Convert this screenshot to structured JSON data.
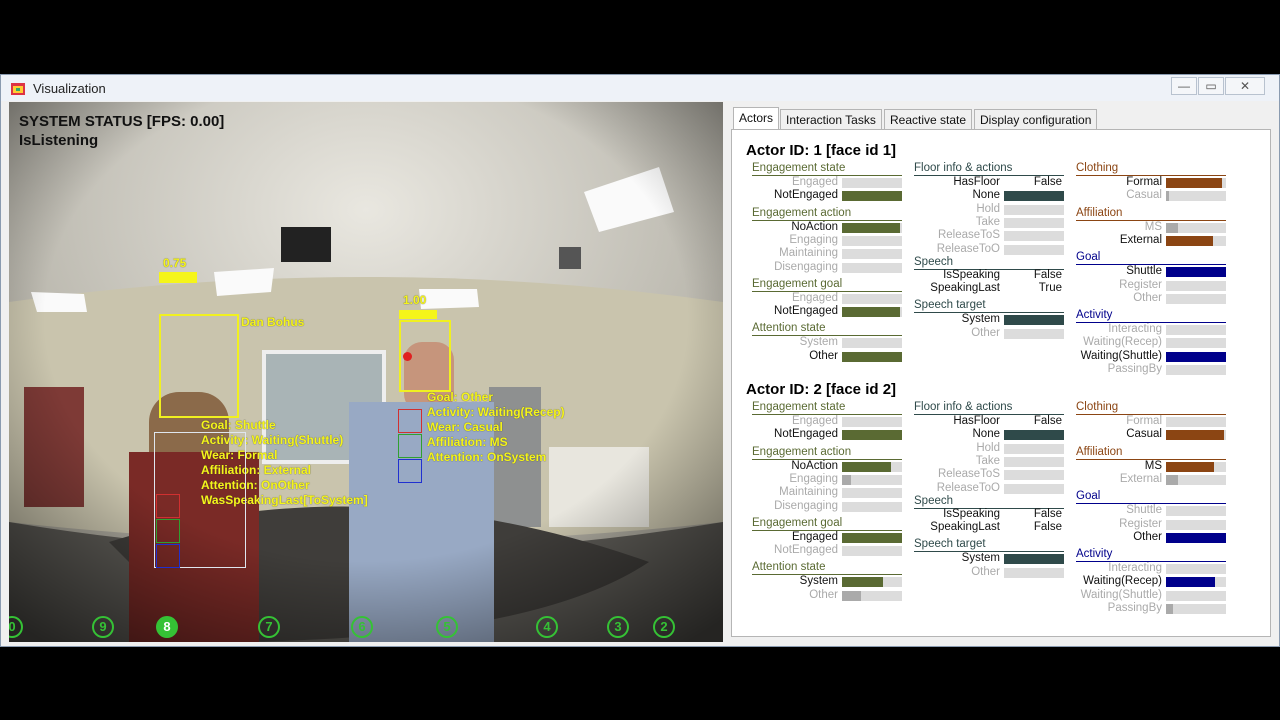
{
  "window": {
    "title": "Visualization",
    "minimize": "—",
    "restore": "▭",
    "close": "✕"
  },
  "camera": {
    "status_line1": "SYSTEM STATUS [FPS: 0.00]",
    "status_line2": "IsListening",
    "person1": {
      "confidence": "0.75",
      "name": "Dan Bohus",
      "lines": [
        "Goal: Shuttle",
        "Activity: Waiting(Shuttle)",
        "Wear: Formal",
        "Affiliation: External",
        "Attention: OnOther",
        "WasSpeakingLast[ToSystem]"
      ]
    },
    "person2": {
      "confidence": "1.00",
      "lines": [
        "Goal: Other",
        "Activity: Waiting(Recep)",
        "Wear: Casual",
        "Affiliation: MS",
        "Attention: OnSystem"
      ]
    },
    "markers": [
      {
        "label": "0",
        "active": false
      },
      {
        "label": "9",
        "active": false
      },
      {
        "label": "8",
        "active": true
      },
      {
        "label": "7",
        "active": false
      },
      {
        "label": "6",
        "active": false
      },
      {
        "label": "5",
        "active": false
      },
      {
        "label": "4",
        "active": false
      },
      {
        "label": "3",
        "active": false
      },
      {
        "label": "2",
        "active": false
      }
    ]
  },
  "tabs": [
    "Actors",
    "Interaction Tasks",
    "Reactive state",
    "Display configuration"
  ],
  "active_tab": "Actors",
  "colors": {
    "olive": "#5a6a33",
    "slate": "#2f4a4a",
    "brown": "#8b4513",
    "navy": "#00008b",
    "bar_bg": "#dcdcdc"
  },
  "actors": [
    {
      "title": "Actor ID: 1 [face id 1]",
      "col1": [
        {
          "section": "Engagement state",
          "items": [
            {
              "label": "Engaged",
              "value": 0.0,
              "active": false
            },
            {
              "label": "NotEngaged",
              "value": 1.0,
              "active": true
            }
          ]
        },
        {
          "section": "Engagement action",
          "items": [
            {
              "label": "NoAction",
              "value": 0.97,
              "active": true
            },
            {
              "label": "Engaging",
              "value": 0.0,
              "active": false
            },
            {
              "label": "Maintaining",
              "value": 0.0,
              "active": false
            },
            {
              "label": "Disengaging",
              "value": 0.0,
              "active": false
            }
          ]
        },
        {
          "section": "Engagement goal",
          "items": [
            {
              "label": "Engaged",
              "value": 0.0,
              "active": false
            },
            {
              "label": "NotEngaged",
              "value": 0.97,
              "active": true
            }
          ]
        },
        {
          "section": "Attention state",
          "items": [
            {
              "label": "System",
              "value": 0.0,
              "active": false
            },
            {
              "label": "Other",
              "value": 1.0,
              "active": true
            }
          ]
        }
      ],
      "col2": {
        "floor_title": "Floor info & actions",
        "floor": [
          {
            "label": "HasFloor",
            "text": "False"
          },
          {
            "label": "None",
            "value": 1.0,
            "active": true
          },
          {
            "label": "Hold",
            "value": 0.0,
            "active": false
          },
          {
            "label": "Take",
            "value": 0.0,
            "active": false
          },
          {
            "label": "ReleaseToS",
            "value": 0.0,
            "active": false
          },
          {
            "label": "ReleaseToO",
            "value": 0.0,
            "active": false
          }
        ],
        "speech_title": "Speech",
        "speech": [
          {
            "label": "IsSpeaking",
            "text": "False"
          },
          {
            "label": "SpeakingLast",
            "text": "True"
          }
        ],
        "target_title": "Speech target",
        "target": [
          {
            "label": "System",
            "value": 1.0,
            "active": true
          },
          {
            "label": "Other",
            "value": 0.0,
            "active": false
          }
        ]
      },
      "col3": [
        {
          "section": "Clothing",
          "items": [
            {
              "label": "Formal",
              "value": 0.93,
              "active": true
            },
            {
              "label": "Casual",
              "value": 0.05,
              "active": false
            }
          ]
        },
        {
          "section": "Affiliation",
          "items": [
            {
              "label": "MS",
              "value": 0.2,
              "active": false
            },
            {
              "label": "External",
              "value": 0.78,
              "active": true
            }
          ]
        },
        {
          "section": "Goal",
          "items": [
            {
              "label": "Shuttle",
              "value": 1.0,
              "active": true
            },
            {
              "label": "Register",
              "value": 0.0,
              "active": false
            },
            {
              "label": "Other",
              "value": 0.0,
              "active": false
            }
          ]
        },
        {
          "section": "Activity",
          "items": [
            {
              "label": "Interacting",
              "value": 0.0,
              "active": false
            },
            {
              "label": "Waiting(Recep)",
              "value": 0.0,
              "active": false
            },
            {
              "label": "Waiting(Shuttle)",
              "value": 1.0,
              "active": true
            },
            {
              "label": "PassingBy",
              "value": 0.0,
              "active": false
            }
          ]
        }
      ]
    },
    {
      "title": "Actor ID: 2 [face id 2]",
      "col1": [
        {
          "section": "Engagement state",
          "items": [
            {
              "label": "Engaged",
              "value": 0.0,
              "active": false
            },
            {
              "label": "NotEngaged",
              "value": 1.0,
              "active": true
            }
          ]
        },
        {
          "section": "Engagement action",
          "items": [
            {
              "label": "NoAction",
              "value": 0.82,
              "active": true
            },
            {
              "label": "Engaging",
              "value": 0.15,
              "active": false
            },
            {
              "label": "Maintaining",
              "value": 0.0,
              "active": false
            },
            {
              "label": "Disengaging",
              "value": 0.0,
              "active": false
            }
          ]
        },
        {
          "section": "Engagement goal",
          "items": [
            {
              "label": "Engaged",
              "value": 1.0,
              "active": true
            },
            {
              "label": "NotEngaged",
              "value": 0.0,
              "active": false
            }
          ]
        },
        {
          "section": "Attention state",
          "items": [
            {
              "label": "System",
              "value": 0.68,
              "active": true
            },
            {
              "label": "Other",
              "value": 0.32,
              "active": false
            }
          ]
        }
      ],
      "col2": {
        "floor_title": "Floor info & actions",
        "floor": [
          {
            "label": "HasFloor",
            "text": "False"
          },
          {
            "label": "None",
            "value": 1.0,
            "active": true
          },
          {
            "label": "Hold",
            "value": 0.0,
            "active": false
          },
          {
            "label": "Take",
            "value": 0.0,
            "active": false
          },
          {
            "label": "ReleaseToS",
            "value": 0.0,
            "active": false
          },
          {
            "label": "ReleaseToO",
            "value": 0.0,
            "active": false
          }
        ],
        "speech_title": "Speech",
        "speech": [
          {
            "label": "IsSpeaking",
            "text": "False"
          },
          {
            "label": "SpeakingLast",
            "text": "False"
          }
        ],
        "target_title": "Speech target",
        "target": [
          {
            "label": "System",
            "value": 1.0,
            "active": true
          },
          {
            "label": "Other",
            "value": 0.0,
            "active": false
          }
        ]
      },
      "col3": [
        {
          "section": "Clothing",
          "items": [
            {
              "label": "Formal",
              "value": 0.0,
              "active": false
            },
            {
              "label": "Casual",
              "value": 0.97,
              "active": true
            }
          ]
        },
        {
          "section": "Affiliation",
          "items": [
            {
              "label": "MS",
              "value": 0.8,
              "active": true
            },
            {
              "label": "External",
              "value": 0.2,
              "active": false
            }
          ]
        },
        {
          "section": "Goal",
          "items": [
            {
              "label": "Shuttle",
              "value": 0.0,
              "active": false
            },
            {
              "label": "Register",
              "value": 0.0,
              "active": false
            },
            {
              "label": "Other",
              "value": 1.0,
              "active": true
            }
          ]
        },
        {
          "section": "Activity",
          "items": [
            {
              "label": "Interacting",
              "value": 0.0,
              "active": false
            },
            {
              "label": "Waiting(Recep)",
              "value": 0.82,
              "active": true
            },
            {
              "label": "Waiting(Shuttle)",
              "value": 0.0,
              "active": false
            },
            {
              "label": "PassingBy",
              "value": 0.12,
              "active": false
            }
          ]
        }
      ]
    }
  ]
}
